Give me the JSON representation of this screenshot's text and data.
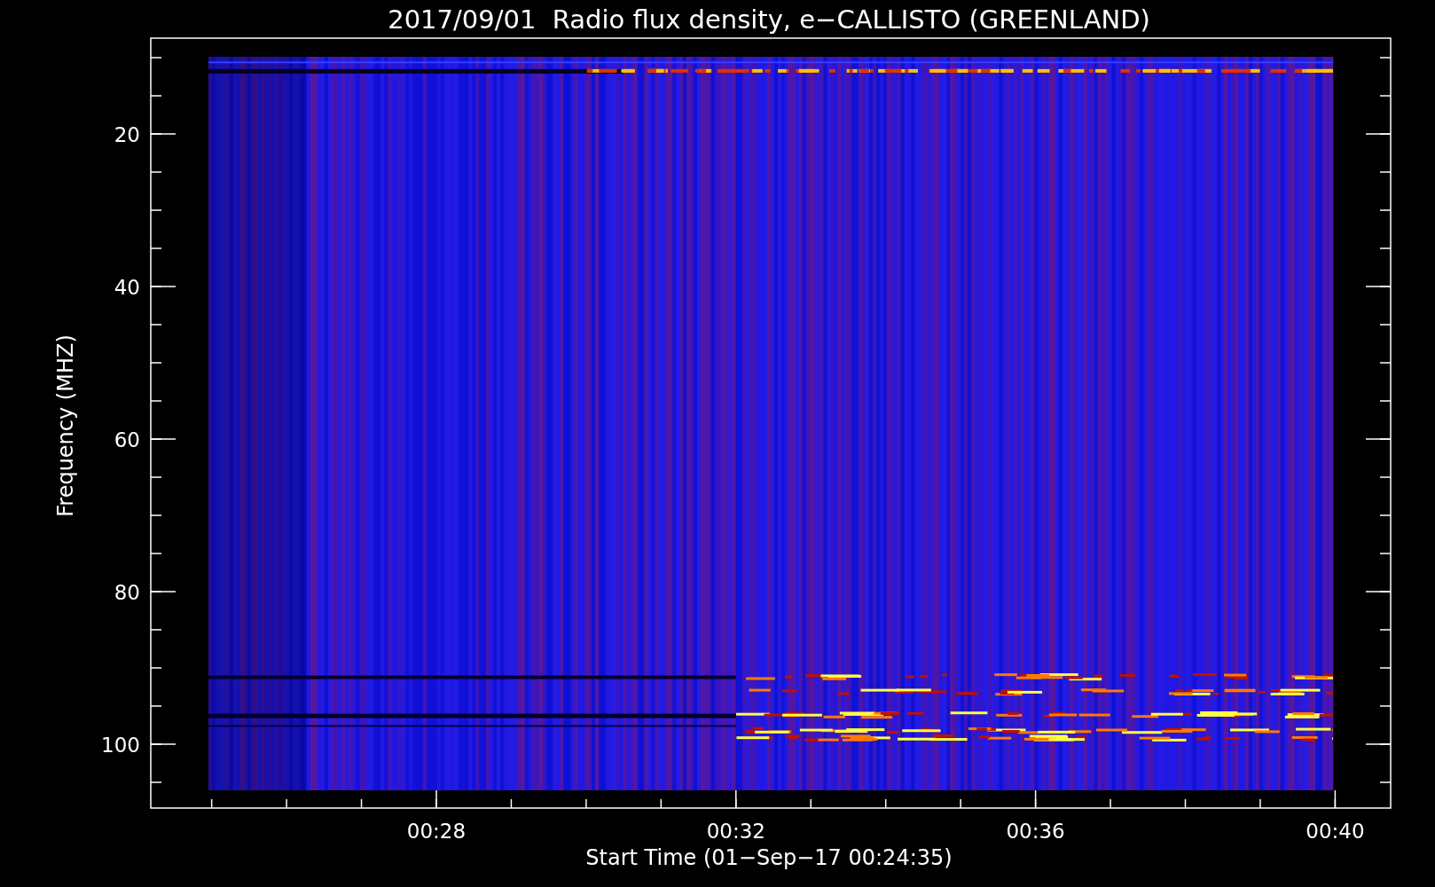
{
  "title": "2017/09/01  Radio flux density, e−CALLISTO (GREENLAND)",
  "y_axis": {
    "label": "Frequency (MHZ)",
    "ticks": [
      "20",
      "40",
      "60",
      "80",
      "100"
    ]
  },
  "x_axis": {
    "label": "Start Time (01−Sep−17 00:24:35)",
    "ticks": [
      "00:28",
      "00:32",
      "00:36",
      "00:40"
    ]
  }
}
